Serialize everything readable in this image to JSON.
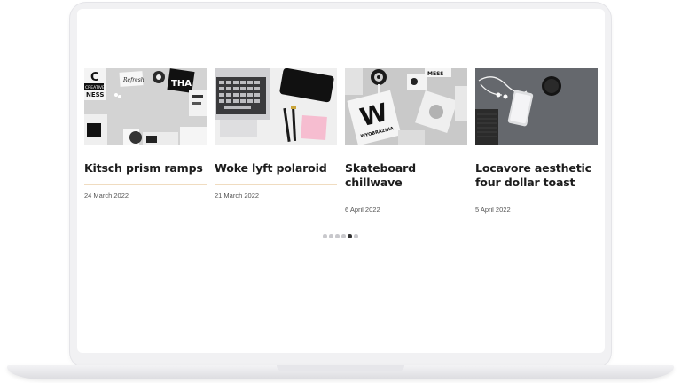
{
  "cards": [
    {
      "title": "Kitsch prism ramps",
      "date": "24 March 2022",
      "image": "desk-flatlay-creative-posters"
    },
    {
      "title": "Woke lyft polaroid",
      "date": "21 March 2022",
      "image": "laptop-phone-pens-sticky-note"
    },
    {
      "title": "Skateboard chillwave",
      "date": "6 April 2022",
      "image": "magazine-lollipop-posters"
    },
    {
      "title": "Locavore aesthetic four dollar toast",
      "date": "5 April 2022",
      "image": "grey-desk-phone-earphones-mug"
    }
  ],
  "image_text": {
    "card1_a": "C",
    "card1_b": "CREATIVE",
    "card1_c": "NESS",
    "card1_d": "THA",
    "card1_e": "Refresh",
    "card3_w": "W",
    "card3_brand": "WYOBRAZNIA",
    "card3_mess": "MESS"
  },
  "pagination": {
    "count": 6,
    "active_index": 4
  },
  "colors": {
    "title": "#1d1d1d",
    "rule": "#f0dcc0",
    "date": "#555555",
    "dot_active": "#333333",
    "dot_inactive": "#c8c8cc"
  }
}
